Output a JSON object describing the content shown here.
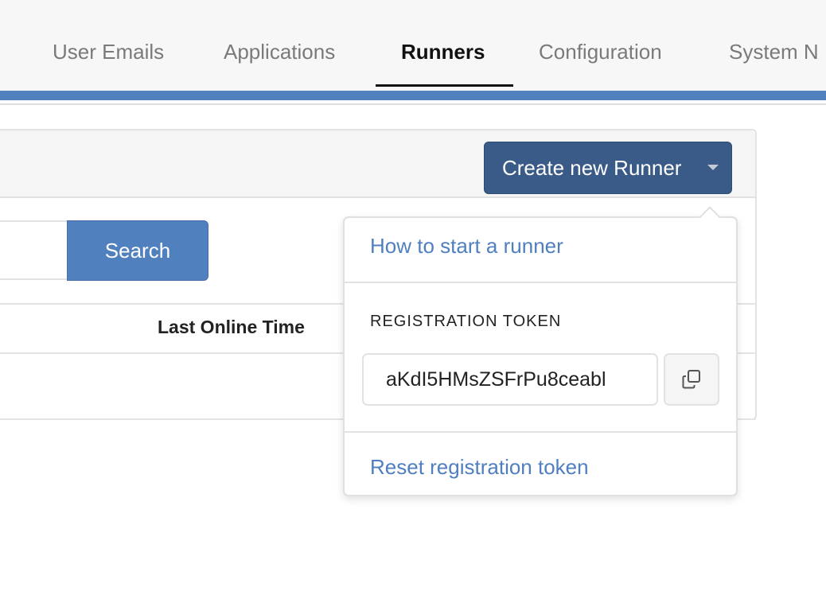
{
  "tabs": [
    {
      "label": "User Emails",
      "active": false
    },
    {
      "label": "Applications",
      "active": false
    },
    {
      "label": "Runners",
      "active": true
    },
    {
      "label": "Configuration",
      "active": false
    },
    {
      "label": "System N",
      "active": false
    }
  ],
  "colors": {
    "accent": "#5180bf",
    "primary_button": "#3a5b87",
    "link": "#4f7fc0"
  },
  "panel": {
    "create_button_label": "Create new Runner",
    "create_button_icon": "caret-down-icon"
  },
  "search": {
    "value": "",
    "button_label": "Search"
  },
  "table": {
    "columns": [
      "Last Online Time"
    ]
  },
  "dropdown": {
    "how_to_link": "How to start a runner",
    "token_label": "REGISTRATION TOKEN",
    "token_value": "aKdI5HMsZSFrPu8ceabl",
    "copy_icon": "copy-icon",
    "reset_link": "Reset registration token"
  }
}
